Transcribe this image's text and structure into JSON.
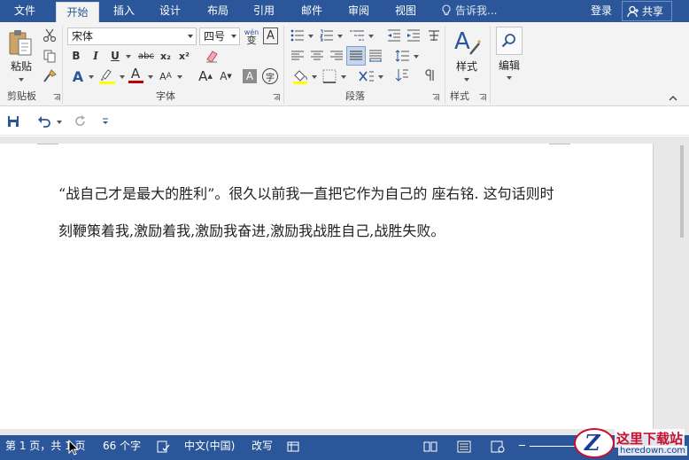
{
  "tabs": {
    "file": "文件",
    "home": "开始",
    "insert": "插入",
    "design": "设计",
    "layout": "布局",
    "references": "引用",
    "mailings": "邮件",
    "review": "审阅",
    "view": "视图"
  },
  "tellme": "告诉我...",
  "login": "登录",
  "share": "共享",
  "ribbon": {
    "clipboard": {
      "paste_label": "粘贴",
      "group_label": "剪贴板"
    },
    "font": {
      "font_name": "宋体",
      "font_size": "四号",
      "wen_label": "wén",
      "wen_char": "变",
      "boxed_a": "A",
      "bold": "B",
      "italic": "I",
      "underline": "U",
      "strike": "abc",
      "subscript": "x₂",
      "superscript": "x²",
      "text_effects": "A",
      "font_color": "A",
      "grow": "A",
      "shrink": "A",
      "shading_a": "A",
      "enclose": "字",
      "group_label": "字体"
    },
    "paragraph": {
      "group_label": "段落"
    },
    "styles": {
      "label": "样式",
      "group_label": "样式"
    },
    "editing": {
      "label": "编辑"
    }
  },
  "document": {
    "paragraph": "“战自己才是最大的胜利”。很久以前我一直把它作为自己的  座右铭.   这句话则时刻鞭策着我,激励着我,激励我奋进,激励我战胜自己,战胜失败。"
  },
  "status": {
    "page": "第 1 页，共 1 页",
    "words": "66 个字",
    "language": "中文(中国)",
    "mode": "改写"
  },
  "watermark": {
    "title": "这里下载站",
    "url": "heredown.com",
    "logo_letter": "Z"
  },
  "colors": {
    "accent": "#2b579a",
    "ribbon_bg": "#f3f3f3",
    "font_color_bar": "#c00000",
    "highlight_bar": "#ffff00"
  }
}
